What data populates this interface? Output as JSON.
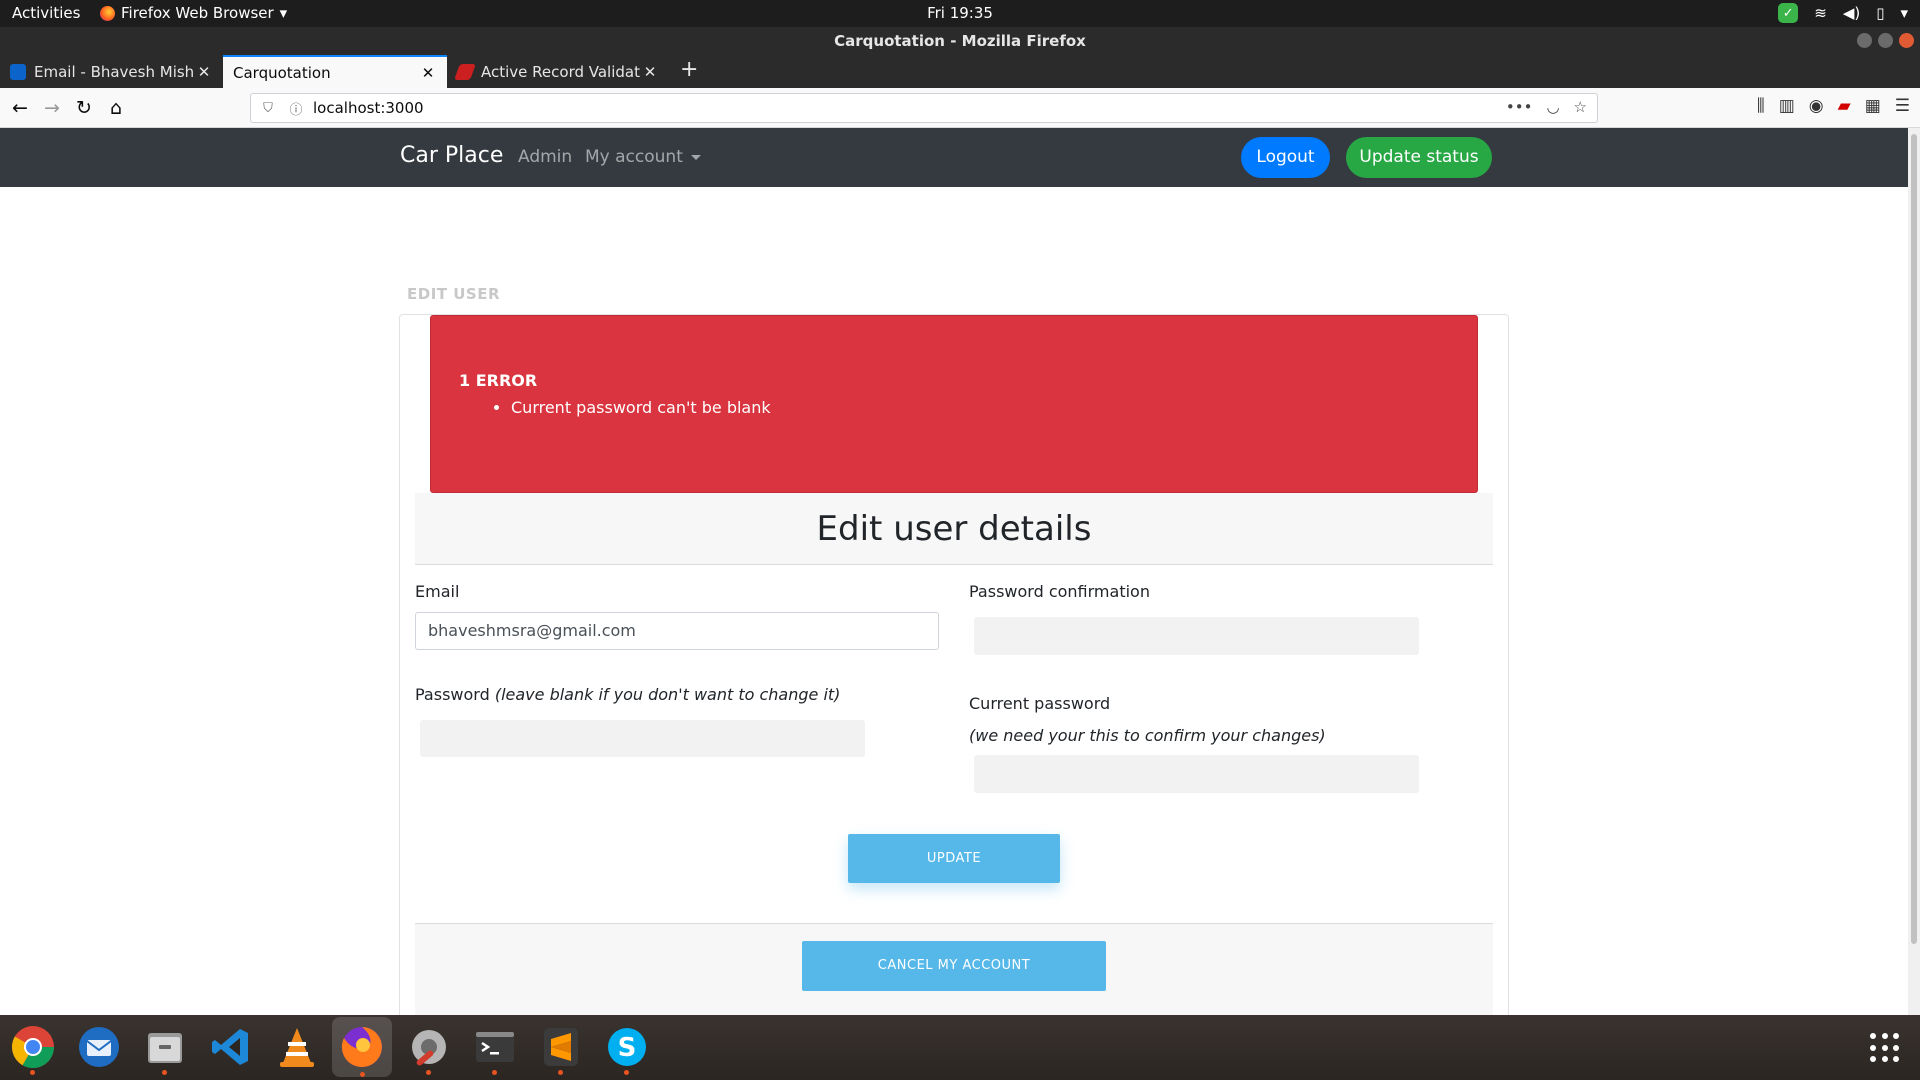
{
  "system_bar": {
    "activities": "Activities",
    "app_menu": "Firefox Web Browser",
    "clock": "Fri 19:35"
  },
  "window": {
    "title": "Carquotation - Mozilla Firefox"
  },
  "tabs": [
    {
      "label": "Email - Bhavesh Mishra -"
    },
    {
      "label": "Carquotation"
    },
    {
      "label": "Active Record Validation"
    }
  ],
  "address_bar": {
    "url": "localhost:3000"
  },
  "site_nav": {
    "brand": "Car Place",
    "links": [
      "Admin",
      "My account"
    ],
    "logout": "Logout",
    "update_status": "Update status"
  },
  "page": {
    "section_title": "EDIT USER",
    "error_count": "1 ERROR",
    "errors": [
      "Current password can't be blank"
    ],
    "card_title": "Edit user details",
    "email_label": "Email",
    "email_value": "bhaveshmsra@gmail.com",
    "password_label": "Password",
    "password_hint": "(leave blank if you don't want to change it)",
    "password_confirmation_label": "Password confirmation",
    "current_password_label": "Current password",
    "current_password_hint": "(we need your this to confirm your changes)",
    "update_button": "UPDATE",
    "cancel_button": "CANCEL MY ACCOUNT"
  },
  "colors": {
    "navbar": "#343a40",
    "logout_button": "#007bff",
    "update_status_button": "#28a745",
    "error_alert": "#d9343f",
    "form_buttons": "#55b8e8"
  },
  "dock": [
    "chrome-icon",
    "thunderbird-icon",
    "files-icon",
    "vscode-icon",
    "vlc-icon",
    "firefox-icon",
    "settings-icon",
    "terminal-icon",
    "sublime-icon",
    "skype-icon"
  ]
}
